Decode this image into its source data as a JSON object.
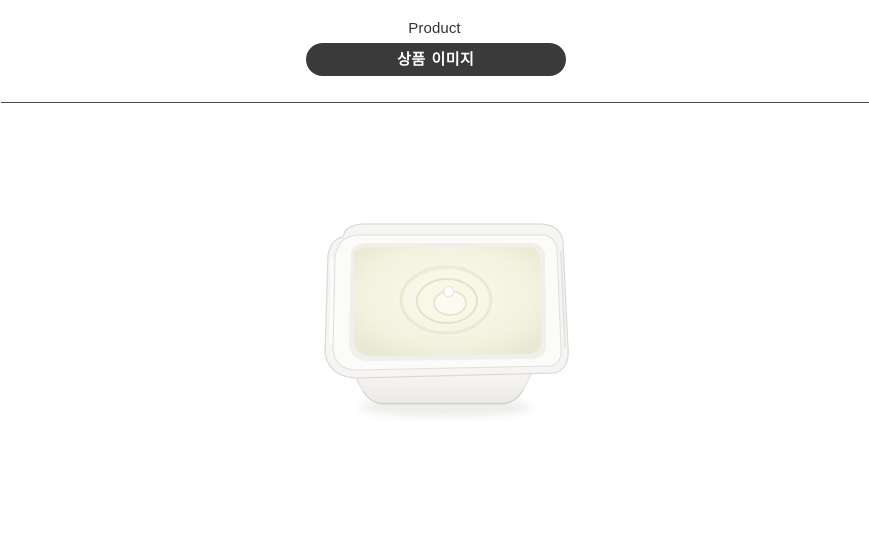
{
  "header": {
    "eyebrow": "Product",
    "title": "상품 이미지"
  },
  "product_image": {
    "subject": "white-yogurt-cup-icon",
    "colors": {
      "cup": "#f4f4f1",
      "cup_shadow": "#dcdcd6",
      "yogurt": "#f3f2df",
      "yogurt_swirl": "#e7e6cc"
    }
  }
}
